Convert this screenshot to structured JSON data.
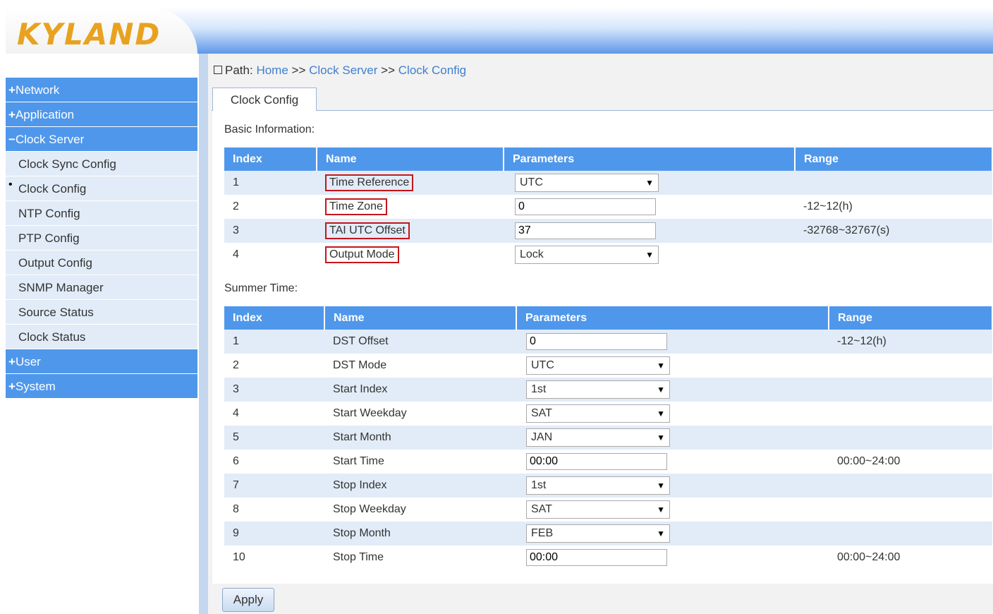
{
  "logo": "KYLAND",
  "sidebar": {
    "items": [
      {
        "sign": "+",
        "label": "Network",
        "type": "top"
      },
      {
        "sign": "+",
        "label": "Application",
        "type": "top"
      },
      {
        "sign": "−",
        "label": "Clock Server",
        "type": "top"
      },
      {
        "label": "Clock Sync Config",
        "type": "sub"
      },
      {
        "label": "Clock Config",
        "type": "sub",
        "selected": true
      },
      {
        "label": "NTP Config",
        "type": "sub"
      },
      {
        "label": "PTP Config",
        "type": "sub"
      },
      {
        "label": "Output Config",
        "type": "sub"
      },
      {
        "label": "SNMP Manager",
        "type": "sub"
      },
      {
        "label": "Source Status",
        "type": "sub"
      },
      {
        "label": "Clock Status",
        "type": "sub"
      },
      {
        "sign": "+",
        "label": "User",
        "type": "top"
      },
      {
        "sign": "+",
        "label": "System",
        "type": "top"
      }
    ]
  },
  "breadcrumb": {
    "prefix": "Path:",
    "home": "Home",
    "sep": ">>",
    "section": "Clock Server",
    "page": "Clock Config"
  },
  "tab": {
    "label": "Clock Config"
  },
  "basic": {
    "title": "Basic Information:",
    "headers": {
      "index": "Index",
      "name": "Name",
      "params": "Parameters",
      "range": "Range"
    },
    "rows": [
      {
        "index": "1",
        "name": "Time Reference",
        "kind": "select",
        "value": "UTC",
        "range": ""
      },
      {
        "index": "2",
        "name": "Time Zone",
        "kind": "input",
        "value": "0",
        "range": "-12~12(h)"
      },
      {
        "index": "3",
        "name": "TAI UTC Offset",
        "kind": "input",
        "value": "37",
        "range": "-32768~32767(s)"
      },
      {
        "index": "4",
        "name": "Output Mode",
        "kind": "select",
        "value": "Lock",
        "range": ""
      }
    ]
  },
  "summer": {
    "title": "Summer Time:",
    "headers": {
      "index": "Index",
      "name": "Name",
      "params": "Parameters",
      "range": "Range"
    },
    "rows": [
      {
        "index": "1",
        "name": "DST Offset",
        "kind": "input",
        "value": "0",
        "range": "-12~12(h)"
      },
      {
        "index": "2",
        "name": "DST Mode",
        "kind": "select",
        "value": "UTC",
        "range": ""
      },
      {
        "index": "3",
        "name": "Start Index",
        "kind": "select",
        "value": "1st",
        "range": ""
      },
      {
        "index": "4",
        "name": "Start Weekday",
        "kind": "select",
        "value": "SAT",
        "range": ""
      },
      {
        "index": "5",
        "name": "Start Month",
        "kind": "select",
        "value": "JAN",
        "range": ""
      },
      {
        "index": "6",
        "name": "Start Time",
        "kind": "input",
        "value": "00:00",
        "range": "00:00~24:00"
      },
      {
        "index": "7",
        "name": "Stop Index",
        "kind": "select",
        "value": "1st",
        "range": ""
      },
      {
        "index": "8",
        "name": "Stop Weekday",
        "kind": "select",
        "value": "SAT",
        "range": ""
      },
      {
        "index": "9",
        "name": "Stop Month",
        "kind": "select",
        "value": "FEB",
        "range": ""
      },
      {
        "index": "10",
        "name": "Stop Time",
        "kind": "input",
        "value": "00:00",
        "range": "00:00~24:00"
      }
    ]
  },
  "apply_label": "Apply",
  "colors": {
    "header_blue": "#4f97eb",
    "row_tint": "#e2ecf8",
    "highlight_red": "#c4161c",
    "logo_orange": "#e9a21f",
    "link_blue": "#3f7fcf"
  }
}
